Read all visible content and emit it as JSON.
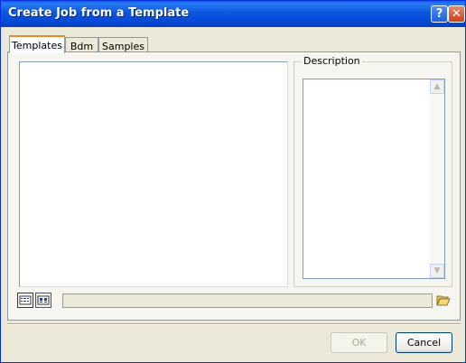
{
  "window": {
    "title": "Create Job from a Template",
    "help_glyph": "?",
    "close_glyph": "✕"
  },
  "tabs": [
    {
      "label": "Templates",
      "active": true
    },
    {
      "label": "Bdm",
      "active": false
    },
    {
      "label": "Samples",
      "active": false
    }
  ],
  "description": {
    "label": "Description",
    "scroll_up": "▲",
    "scroll_down": "▼"
  },
  "toolbar": {
    "view_list_icon": "list-view-icon",
    "view_details_icon": "details-view-icon",
    "path_value": "",
    "browse_icon": "folder-open-icon"
  },
  "buttons": {
    "ok": "OK",
    "cancel": "Cancel",
    "ok_enabled": false
  },
  "colors": {
    "title_bar": "#0a5be8",
    "dialog_bg": "#ece9d8",
    "active_tab_accent": "#e68b2c"
  }
}
